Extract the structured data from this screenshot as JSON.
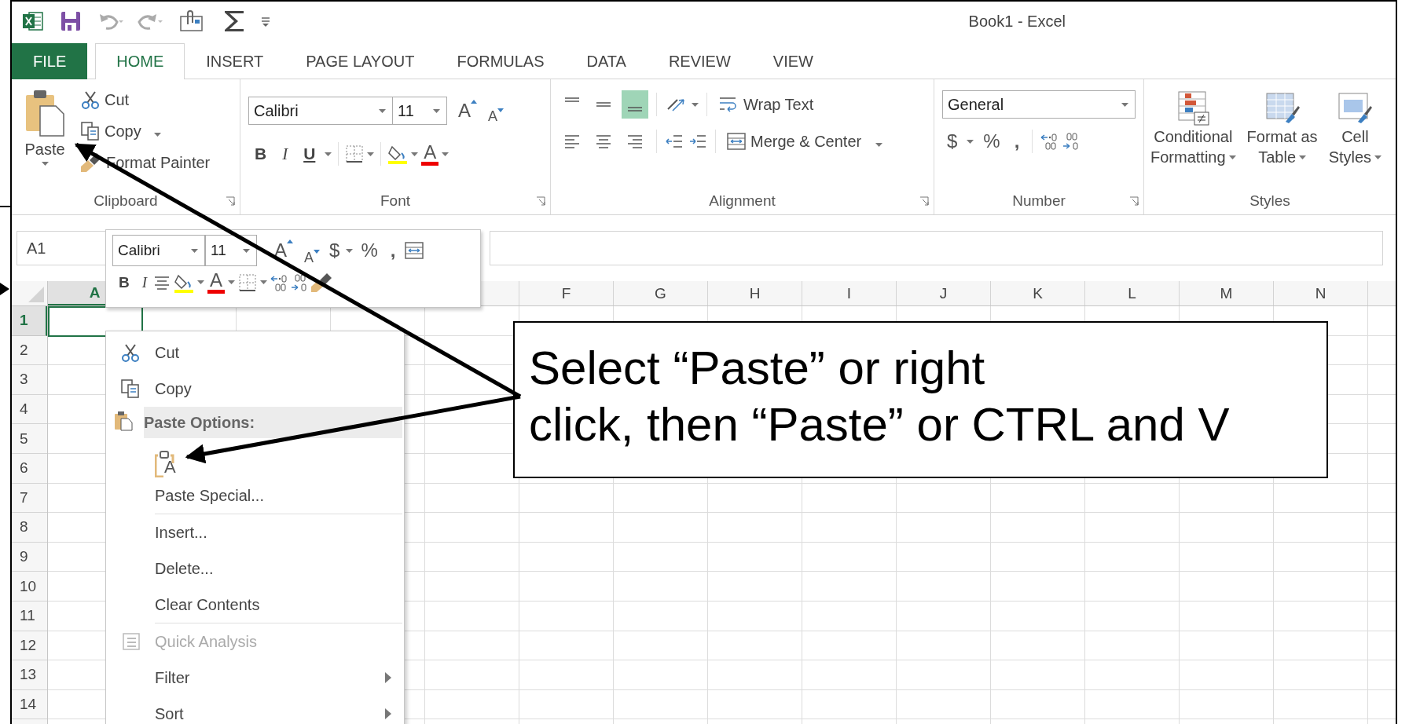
{
  "title_bar": {
    "title": "Book1 - Excel"
  },
  "ribbon_tabs": [
    {
      "label": "FILE",
      "kind": "file",
      "selected": false
    },
    {
      "label": "HOME",
      "kind": "tab",
      "selected": true
    },
    {
      "label": "INSERT",
      "kind": "tab",
      "selected": false
    },
    {
      "label": "PAGE LAYOUT",
      "kind": "tab",
      "selected": false
    },
    {
      "label": "FORMULAS",
      "kind": "tab",
      "selected": false
    },
    {
      "label": "DATA",
      "kind": "tab",
      "selected": false
    },
    {
      "label": "REVIEW",
      "kind": "tab",
      "selected": false
    },
    {
      "label": "VIEW",
      "kind": "tab",
      "selected": false
    }
  ],
  "ribbon": {
    "clipboard": {
      "label": "Clipboard",
      "paste": "Paste",
      "cut": "Cut",
      "copy": "Copy",
      "format_painter": "Format Painter"
    },
    "font": {
      "label": "Font",
      "font_name": "Calibri",
      "font_size": "11",
      "grow_font": "A",
      "shrink_font": "A",
      "bold": "B",
      "italic": "I",
      "underline": "U",
      "font_color": "A"
    },
    "alignment": {
      "label": "Alignment",
      "vertical_align": [
        {
          "selected": false
        },
        {
          "selected": false
        },
        {
          "selected": true
        }
      ],
      "wrap_text": "Wrap Text",
      "merge_center": "Merge & Center"
    },
    "number": {
      "label": "Number",
      "format": "General",
      "currency": "$",
      "percent": "%",
      "comma": ","
    },
    "styles": {
      "label": "Styles",
      "buttons": [
        {
          "kind": "conditional",
          "lines": [
            "Conditional",
            "Formatting"
          ]
        },
        {
          "kind": "table",
          "lines": [
            "Format as",
            "Table"
          ]
        },
        {
          "kind": "cell",
          "lines": [
            "Cell",
            "Styles"
          ]
        }
      ]
    }
  },
  "name_box": "A1",
  "mini_toolbar": {
    "font_name": "Calibri",
    "font_size": "11",
    "grow_font": "A",
    "shrink_font": "A",
    "currency": "$",
    "percent": "%",
    "comma": ",",
    "bold": "B",
    "italic": "I",
    "font_color": "A"
  },
  "sheet": {
    "columns": [
      {
        "label": "A",
        "selected": true
      },
      {
        "label": "F",
        "selected": false
      },
      {
        "label": "G",
        "selected": false
      },
      {
        "label": "H",
        "selected": false
      },
      {
        "label": "I",
        "selected": false
      },
      {
        "label": "J",
        "selected": false
      },
      {
        "label": "K",
        "selected": false
      },
      {
        "label": "L",
        "selected": false
      },
      {
        "label": "M",
        "selected": false
      },
      {
        "label": "N",
        "selected": false
      }
    ],
    "rows": [
      {
        "label": "1",
        "selected": true
      },
      {
        "label": "2",
        "selected": false
      },
      {
        "label": "3",
        "selected": false
      },
      {
        "label": "4",
        "selected": false
      },
      {
        "label": "5",
        "selected": false
      },
      {
        "label": "6",
        "selected": false
      },
      {
        "label": "7",
        "selected": false
      },
      {
        "label": "8",
        "selected": false
      },
      {
        "label": "9",
        "selected": false
      },
      {
        "label": "10",
        "selected": false
      },
      {
        "label": "11",
        "selected": false
      },
      {
        "label": "12",
        "selected": false
      },
      {
        "label": "13",
        "selected": false
      },
      {
        "label": "14",
        "selected": false
      }
    ]
  },
  "context_menu": {
    "items": [
      {
        "kind": "cut",
        "label": "Cut",
        "disabled": false
      },
      {
        "kind": "copy",
        "label": "Copy",
        "disabled": false
      },
      {
        "kind": "header",
        "label": "Paste Options:",
        "disabled": false
      },
      {
        "kind": "paste_option",
        "label": "A",
        "disabled": false
      },
      {
        "kind": "command",
        "label": "Paste Special...",
        "disabled": false
      },
      {
        "kind": "separator"
      },
      {
        "kind": "command",
        "label": "Insert...",
        "disabled": false
      },
      {
        "kind": "command",
        "label": "Delete...",
        "disabled": false
      },
      {
        "kind": "command",
        "label": "Clear Contents",
        "disabled": false
      },
      {
        "kind": "separator"
      },
      {
        "kind": "quick_analysis",
        "label": "Quick Analysis",
        "disabled": true
      },
      {
        "kind": "submenu",
        "label": "Filter",
        "disabled": false
      },
      {
        "kind": "submenu",
        "label": "Sort",
        "disabled": false
      }
    ]
  },
  "callout": {
    "lines": [
      "Select “Paste” or right",
      "click, then “Paste” or CTRL and V"
    ]
  }
}
